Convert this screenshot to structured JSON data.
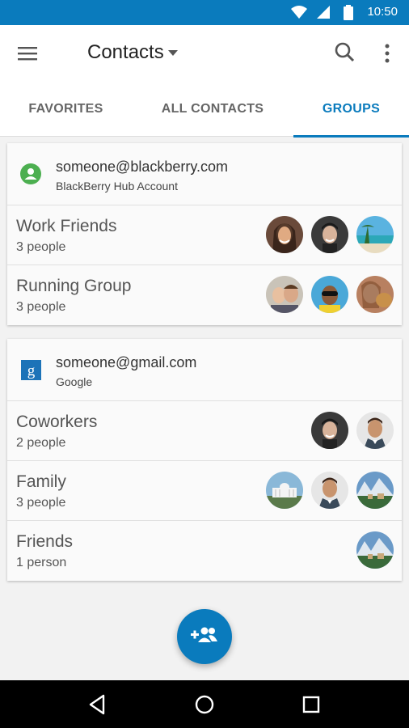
{
  "status_bar": {
    "time": "10:50",
    "icons": [
      "wifi-icon",
      "signal-icon",
      "battery-icon"
    ],
    "background": "#0a7bbd"
  },
  "app_bar": {
    "title": "Contacts",
    "menu_icon": "hamburger-menu-icon",
    "search_icon": "search-icon",
    "more_icon": "more-vert-icon"
  },
  "tabs": [
    {
      "label": "FAVORITES",
      "active": false
    },
    {
      "label": "ALL CONTACTS",
      "active": false
    },
    {
      "label": "GROUPS",
      "active": true
    }
  ],
  "accounts": [
    {
      "email": "someone@blackberry.com",
      "type": "BlackBerry Hub Account",
      "icon": "account-person-icon",
      "groups": [
        {
          "name": "Work Friends",
          "count": "3 people",
          "avatars": [
            "woman-smiling-photo",
            "man-smiling-photo",
            "beach-photo"
          ]
        },
        {
          "name": "Running Group",
          "count": "3 people",
          "avatars": [
            "father-son-photo",
            "girl-sunglasses-photo",
            "woman-dog-photo"
          ]
        }
      ]
    },
    {
      "email": "someone@gmail.com",
      "type": "Google",
      "icon": "google-g-icon",
      "groups": [
        {
          "name": "Coworkers",
          "count": "2 people",
          "avatars": [
            "man-smiling-photo",
            "man-suit-photo"
          ]
        },
        {
          "name": "Family",
          "count": "3 people",
          "avatars": [
            "white-house-photo",
            "man-suit-photo",
            "mountain-village-photo"
          ]
        },
        {
          "name": "Friends",
          "count": "1 person",
          "avatars": [
            "mountain-village-photo"
          ]
        }
      ]
    }
  ],
  "fab": {
    "icon": "add-group-icon"
  },
  "nav_bar": {
    "icons": [
      "back-icon",
      "home-icon",
      "recents-icon"
    ]
  },
  "colors": {
    "accent": "#0a7bbd",
    "account_green": "#4caf50",
    "google_blue": "#1c73b8"
  }
}
